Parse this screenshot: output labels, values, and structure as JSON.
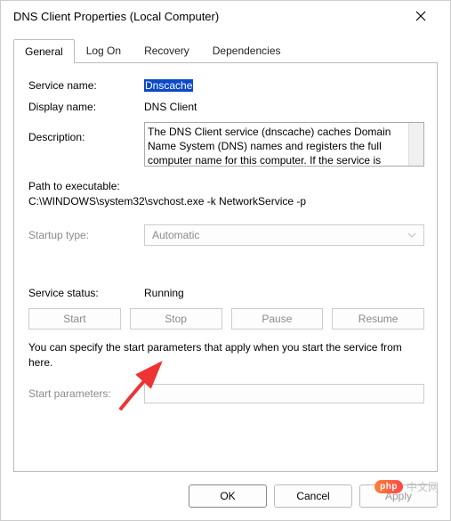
{
  "window": {
    "title": "DNS Client Properties (Local Computer)"
  },
  "tabs": {
    "t1": "General",
    "t2": "Log On",
    "t3": "Recovery",
    "t4": "Dependencies"
  },
  "labels": {
    "service_name": "Service name:",
    "display_name": "Display name:",
    "description": "Description:",
    "path_label": "Path to executable:",
    "startup_type": "Startup type:",
    "service_status": "Service status:",
    "start_params": "Start parameters:"
  },
  "values": {
    "service_name": "Dnscache",
    "display_name": "DNS Client",
    "description_text": "The DNS Client service (dnscache) caches Domain Name System (DNS) names and registers the full computer name for this computer. If the service is",
    "path": "C:\\WINDOWS\\system32\\svchost.exe -k NetworkService -p",
    "startup_type": "Automatic",
    "status": "Running",
    "start_params": ""
  },
  "buttons": {
    "start": "Start",
    "stop": "Stop",
    "pause": "Pause",
    "resume": "Resume",
    "ok": "OK",
    "cancel": "Cancel",
    "apply": "Apply"
  },
  "hint": "You can specify the start parameters that apply when you start the service from here.",
  "watermark": {
    "pill": "php",
    "text": "中文网"
  }
}
